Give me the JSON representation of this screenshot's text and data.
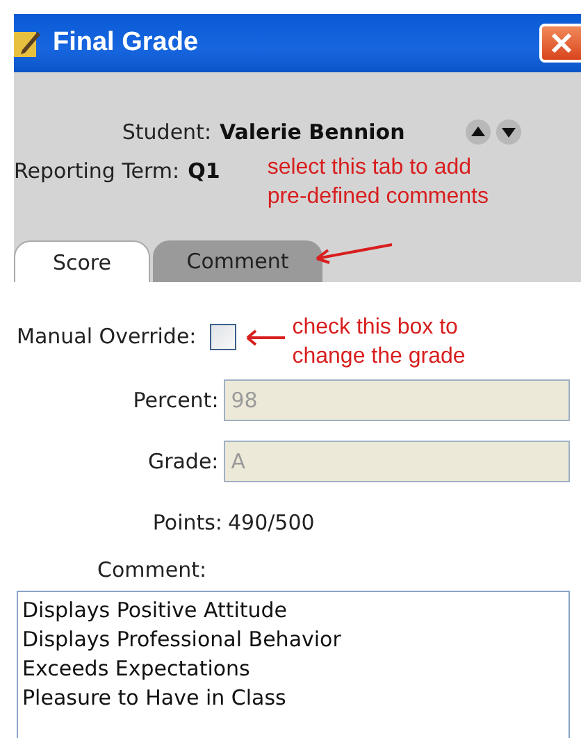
{
  "window": {
    "title": "Final Grade"
  },
  "student": {
    "label": "Student:",
    "name": "Valerie Bennion"
  },
  "term": {
    "label": "Reporting Term:",
    "value": "Q1"
  },
  "tab_note": {
    "lines": [
      "select this tab to add",
      "pre-defined comments"
    ]
  },
  "tabs": [
    {
      "label": "Score",
      "selected": true
    },
    {
      "label": "Comment",
      "selected": false
    }
  ],
  "override": {
    "label": "Manual Override:",
    "checked": false,
    "note_lines": [
      "check this box to",
      "change the grade"
    ]
  },
  "fields": [
    {
      "label": "Percent:",
      "value": "98",
      "disabled": true
    },
    {
      "label": "Grade:",
      "value": "A",
      "disabled": true
    }
  ],
  "points": {
    "label": "Points:",
    "value": "490/500"
  },
  "comment": {
    "label": "Comment:",
    "items": [
      "Displays Positive Attitude",
      "Displays Professional Behavior",
      "Exceeds Expectations",
      "Pleasure to Have in Class"
    ]
  }
}
